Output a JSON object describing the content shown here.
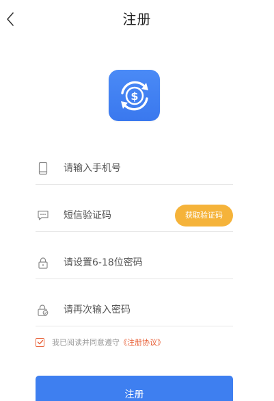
{
  "header": {
    "title": "注册",
    "back_icon": "chevron-left-icon"
  },
  "logo": {
    "icon": "dollar-exchange-icon",
    "background": "#3e7ff0"
  },
  "form": {
    "phone": {
      "icon": "phone-icon",
      "placeholder": "请输入手机号",
      "value": ""
    },
    "sms_code": {
      "icon": "message-icon",
      "placeholder": "短信验证码",
      "value": "",
      "button_label": "获取验证码"
    },
    "password": {
      "icon": "lock-icon",
      "placeholder": "请设置6-18位密码",
      "value": ""
    },
    "confirm_password": {
      "icon": "lock-check-icon",
      "placeholder": "请再次输入密码",
      "value": ""
    }
  },
  "agreement": {
    "checked": true,
    "text": "我已阅读并同意遵守",
    "link_label": "《注册协议》"
  },
  "submit": {
    "label": "注册"
  },
  "colors": {
    "accent": "#3e7ff0",
    "code_button": "#f5b33a",
    "link": "#e8623a"
  }
}
